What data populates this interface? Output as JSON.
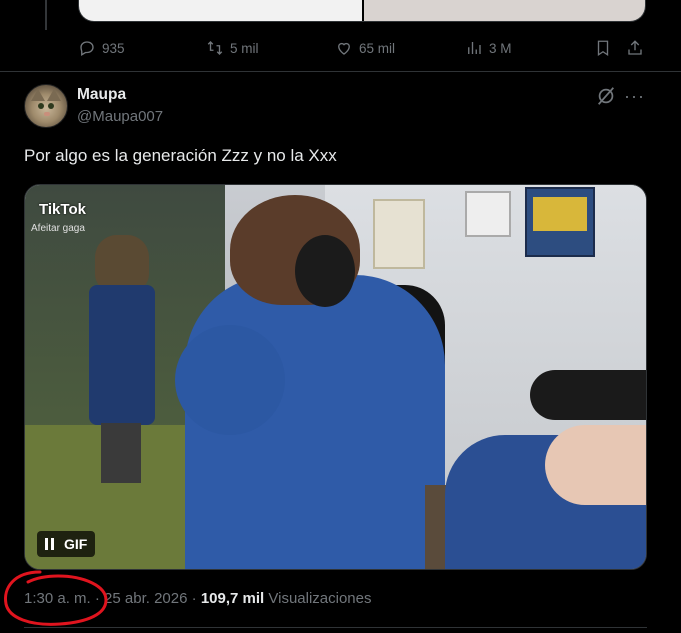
{
  "previous_tweet": {
    "reply_count": "935",
    "retweet_count": "5 mil",
    "like_count": "65 mil",
    "view_count": "3 M"
  },
  "tweet": {
    "author_name": "Maupa",
    "author_handle": "@Maupa007",
    "text": "Por algo es la generación Zzz y no la Xxx",
    "more_glyph": "···",
    "media": {
      "watermark": "TikTok",
      "watermark_sub": "Afeitar gaga",
      "badge_label": "GIF"
    },
    "time": "1:30 a. m.",
    "separator": "·",
    "date": "25 abr. 2026",
    "views_count": "109,7 mil",
    "views_label": "Visualizaciones"
  },
  "annotation": {
    "color": "#e0141e"
  }
}
